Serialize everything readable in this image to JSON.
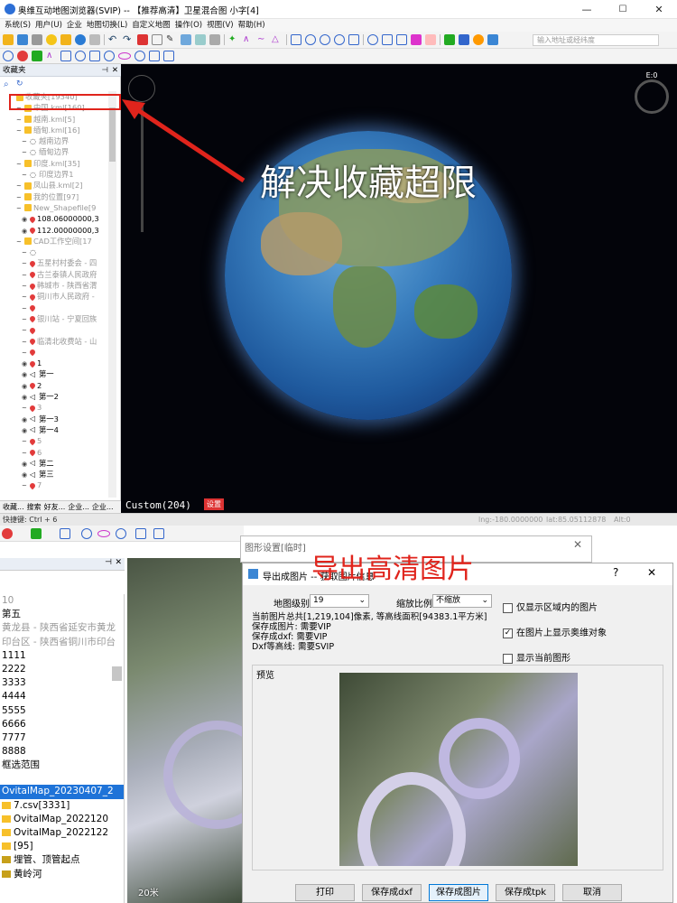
{
  "window": {
    "title": "奥维互动地图浏览器(SVIP) -- 【推荐高清】卫星混合图 小字[4]",
    "icons": [
      "app-logo-icon",
      "minimize-icon",
      "maximize-icon",
      "close-icon"
    ]
  },
  "menu": [
    "系统(S)",
    "用户(U)",
    "企业",
    "地图切换(L)",
    "自定义地图",
    "操作(O)",
    "视图(V)",
    "帮助(H)"
  ],
  "search": {
    "placeholder": "输入地址或经纬度"
  },
  "favorites": {
    "title": "收藏夹",
    "root": "收藏夹[19340]",
    "items": [
      {
        "label": "中国.kml[160]",
        "type": "folder",
        "gray": true
      },
      {
        "label": "越南.kml[5]",
        "type": "folder",
        "gray": true
      },
      {
        "label": "缅甸.kml[16]",
        "type": "folder",
        "gray": true
      },
      {
        "label": "越南边界",
        "type": "line",
        "gray": true
      },
      {
        "label": "缅甸边界",
        "type": "line",
        "gray": true
      },
      {
        "label": "印度.kml[35]",
        "type": "folder",
        "gray": true
      },
      {
        "label": "印度边界1",
        "type": "line",
        "gray": true
      },
      {
        "label": "凤山县.kml[2]",
        "type": "folder",
        "gray": true
      },
      {
        "label": "我的位置[97]",
        "type": "folder",
        "gray": true
      },
      {
        "label": "New_Shapefile[9",
        "type": "folder",
        "gray": true
      },
      {
        "label": "108.06000000,3",
        "type": "pin",
        "gray": false
      },
      {
        "label": "112.00000000,3",
        "type": "pin",
        "gray": false
      },
      {
        "label": "CAD工作空间[17",
        "type": "folder",
        "gray": true
      },
      {
        "label": "",
        "type": "line",
        "gray": true
      },
      {
        "label": "五星村村委会 - 四",
        "type": "pin",
        "gray": true
      },
      {
        "label": "古兰泰镇人民政府",
        "type": "pin",
        "gray": true
      },
      {
        "label": "韩城市 - 陕西省渭",
        "type": "pin",
        "gray": true
      },
      {
        "label": "铜川市人民政府 -",
        "type": "pin",
        "gray": true
      },
      {
        "label": "",
        "type": "pin",
        "gray": true
      },
      {
        "label": "银川站 - 宁夏回族",
        "type": "pin",
        "gray": true
      },
      {
        "label": "",
        "type": "pin",
        "gray": true
      },
      {
        "label": "临清北收费站 - 山",
        "type": "pin",
        "gray": true
      },
      {
        "label": "",
        "type": "pin",
        "gray": true
      },
      {
        "label": "1",
        "type": "pin",
        "gray": false
      },
      {
        "label": "第一",
        "type": "nav",
        "gray": false
      },
      {
        "label": "2",
        "type": "pin",
        "gray": false
      },
      {
        "label": "第一2",
        "type": "nav",
        "gray": false
      },
      {
        "label": "3",
        "type": "pin",
        "gray": true
      },
      {
        "label": "第一3",
        "type": "nav",
        "gray": false
      },
      {
        "label": "第一4",
        "type": "nav",
        "gray": false
      },
      {
        "label": "5",
        "type": "pin",
        "gray": true
      },
      {
        "label": "6",
        "type": "pin",
        "gray": true
      },
      {
        "label": "第二",
        "type": "nav",
        "gray": false
      },
      {
        "label": "第三",
        "type": "nav",
        "gray": false
      },
      {
        "label": "7",
        "type": "pin",
        "gray": true
      }
    ],
    "tabs": [
      "收藏...",
      "搜索",
      "好友...",
      "企业...",
      "企业..."
    ]
  },
  "map": {
    "compass": "E:0",
    "overlay_text": "解决收藏超限",
    "custom_label": "Custom(204)",
    "settings_button": "设置"
  },
  "statusbar": {
    "shortcut": "快捷键: Ctrl + 6",
    "lng": "lng:-180.0000000",
    "lat": "lat:85.05112878",
    "alt": "Alt:0"
  },
  "lower_list": {
    "items": [
      "10",
      "第五",
      "黄龙县 - 陕西省延安市黄龙",
      "印台区 - 陕西省铜川市印台",
      "1111",
      "2222",
      "3333",
      "4444",
      "5555",
      "6666",
      "7777",
      "8888",
      "框选范围"
    ],
    "gray_items": [
      "10",
      "黄龙县 - 陕西省延安市黄龙",
      "印台区 - 陕西省铜川市印台"
    ],
    "folders": [
      "OvitalMap_20230407_2",
      "7.csv[3331]",
      "OvitalMap_2022120",
      "OvitalMap_2022122",
      "[95]",
      "埋管、顶管起点",
      "黄岭河"
    ]
  },
  "scale_label": "20米",
  "graph_settings": {
    "title": "图形设置[临时]"
  },
  "export_dialog": {
    "title": "导出成图片 -- 获取图片信息",
    "overlay_text": "导出高清图片",
    "level_label": "地图级别",
    "level_value": "19",
    "scale_label": "缩放比例",
    "scale_value": "不缩放",
    "info1": "当前图片总共[1,219,104]像素, 等高线面积[94383.1平方米]",
    "info2": "保存成图片: 需要VIP",
    "info3": "保存成dxf: 需要VIP",
    "info4": "Dxf等高线: 需要SVIP",
    "options": [
      {
        "label": "仅显示区域内的图片",
        "checked": false
      },
      {
        "label": "在图片上显示奥维对象",
        "checked": true
      },
      {
        "label": "显示当前图形",
        "checked": false
      }
    ],
    "preview_label": "预览",
    "help": "?",
    "close": "✕",
    "buttons": [
      "打印",
      "保存成dxf",
      "保存成图片",
      "保存成tpk",
      "取消"
    ]
  }
}
